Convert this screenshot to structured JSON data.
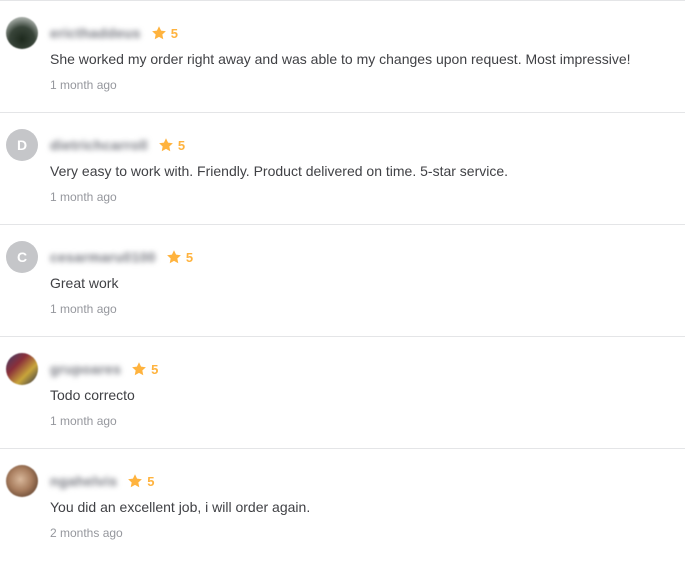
{
  "accent_color": "#ffb33e",
  "reviews": [
    {
      "username": "ericthaddeus",
      "avatar_letter": "",
      "rating": "5",
      "comment": "She worked my order right away and was able to my changes upon request. Most impressive!",
      "time": "1 month ago"
    },
    {
      "username": "dietrichcarroll",
      "avatar_letter": "D",
      "rating": "5",
      "comment": "Very easy to work with. Friendly. Product delivered on time. 5-star service.",
      "time": "1 month ago"
    },
    {
      "username": "cesarmaru0100",
      "avatar_letter": "C",
      "rating": "5",
      "comment": "Great work",
      "time": "1 month ago"
    },
    {
      "username": "grupoares",
      "avatar_letter": "",
      "rating": "5",
      "comment": "Todo correcto",
      "time": "1 month ago"
    },
    {
      "username": "ngahelvis",
      "avatar_letter": "",
      "rating": "5",
      "comment": "You did an excellent job, i will order again.",
      "time": "2 months ago"
    }
  ]
}
